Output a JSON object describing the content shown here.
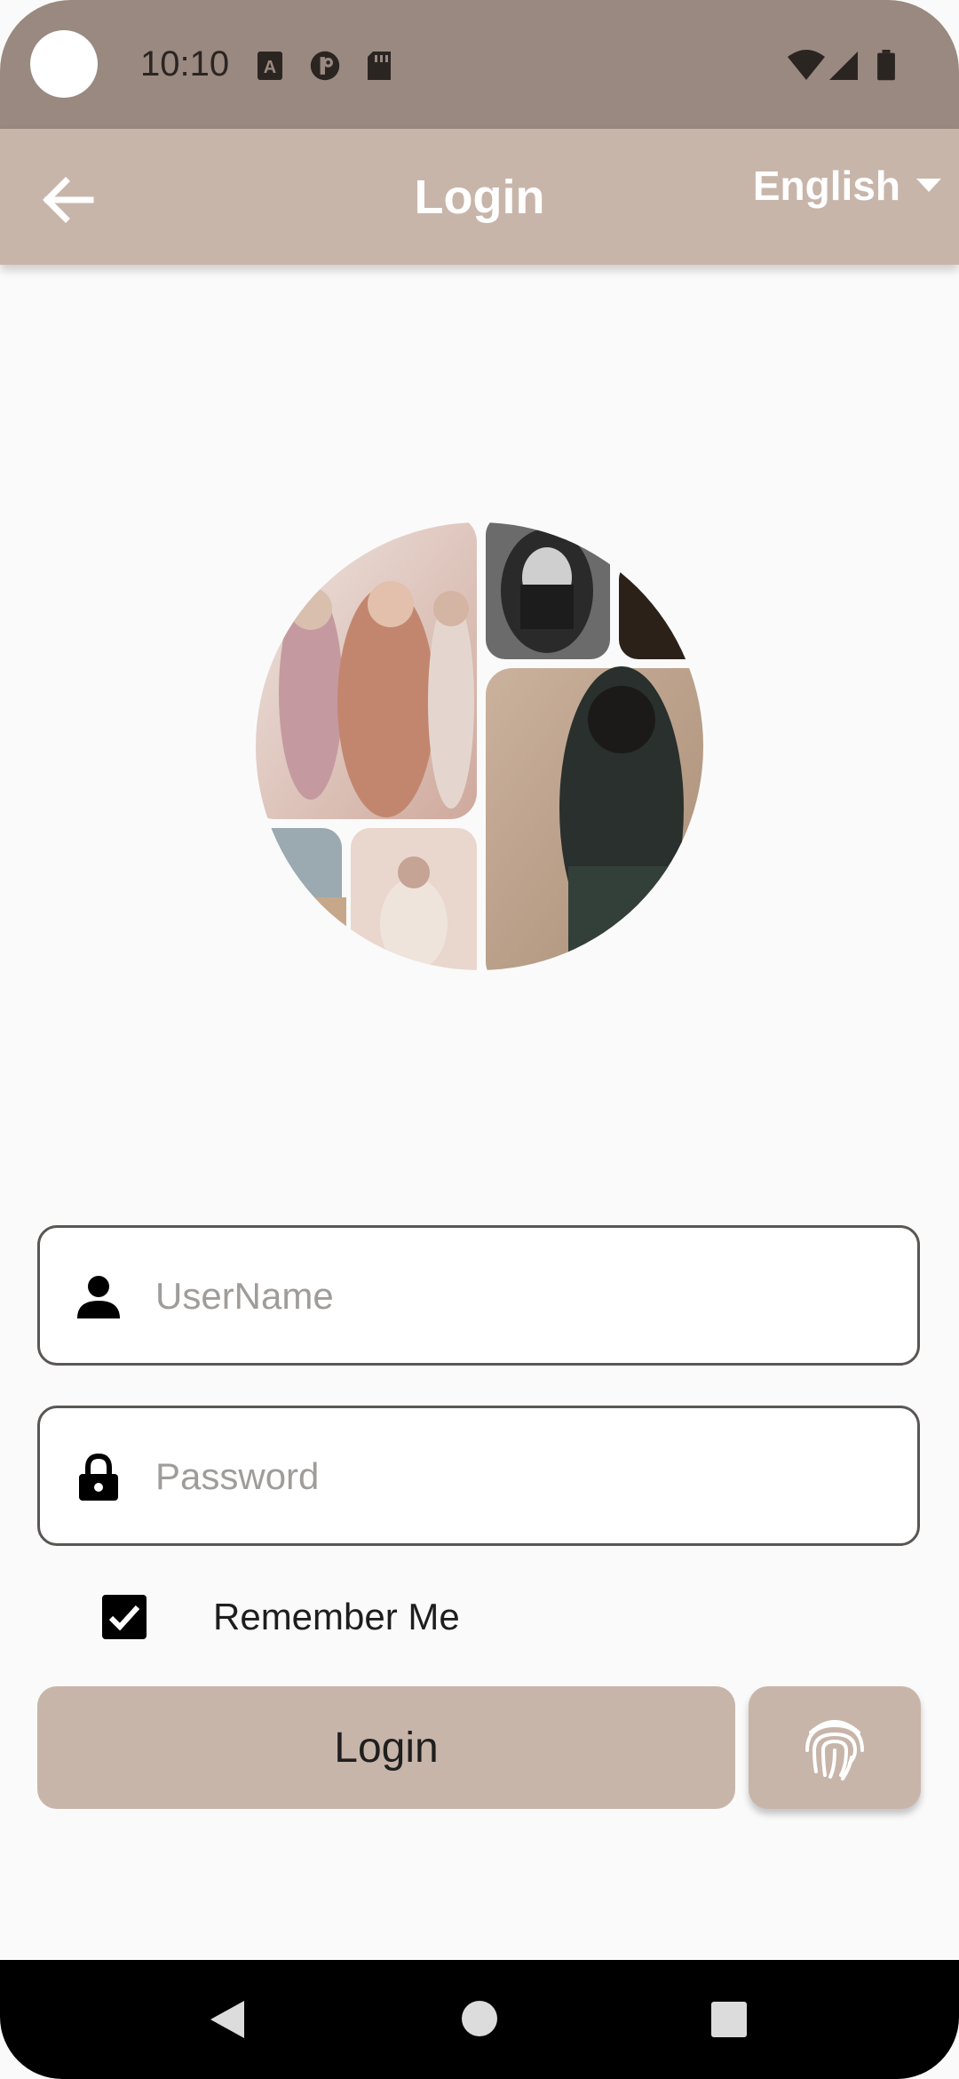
{
  "status_bar": {
    "time": "10:10",
    "left_icons": [
      "text-a-icon",
      "vpn-icon",
      "sd-card-icon"
    ],
    "right_icons": [
      "wifi-icon",
      "signal-icon",
      "battery-icon"
    ]
  },
  "app_bar": {
    "title": "Login",
    "back_icon": "arrow-left-icon",
    "language": "English",
    "background": "#c8b5aa"
  },
  "logo": {
    "description_icon": "photo-collage-logo"
  },
  "form": {
    "username_placeholder": "UserName",
    "username_value": "",
    "password_placeholder": "Password",
    "password_value": "",
    "remember_label": "Remember Me",
    "remember_checked": true,
    "login_label": "Login",
    "fingerprint_icon": "fingerprint-icon"
  },
  "nav_bar": {
    "icons": [
      "back-triangle-icon",
      "home-circle-icon",
      "recents-square-icon"
    ]
  }
}
